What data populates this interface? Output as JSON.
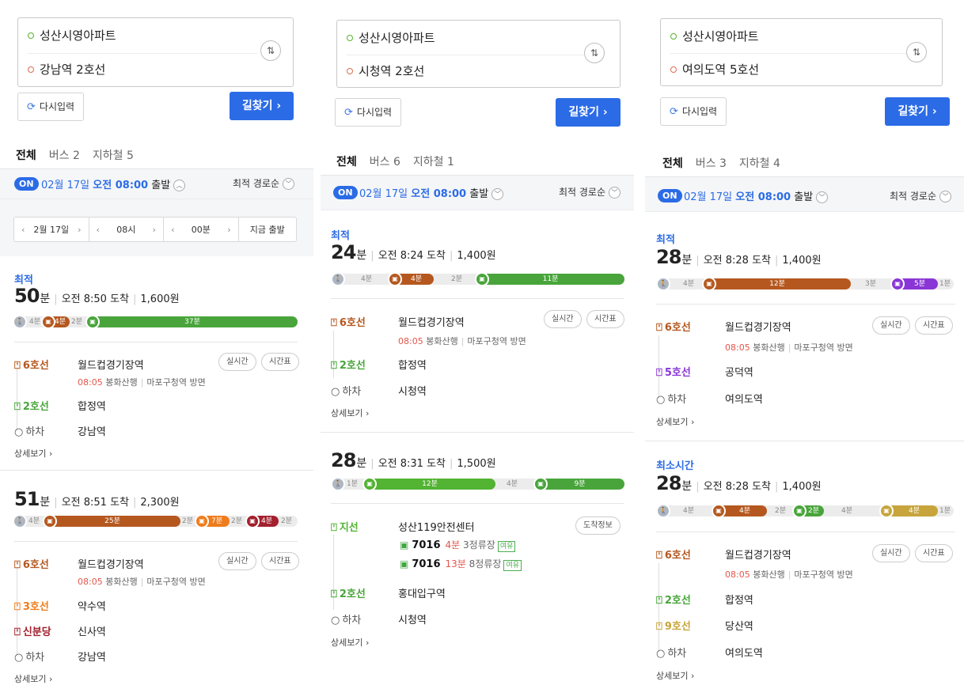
{
  "panels": [
    {
      "from": "성산시영아파트",
      "to": "강남역 2호선",
      "reset": "다시입력",
      "go": "길찾기 ›",
      "tabs": [
        "전체",
        "버스 2",
        "지하철 5"
      ],
      "on": "ON",
      "date": "02월 17일",
      "time": "오전 08:00",
      "dep": "출발",
      "sort": "최적 경로순",
      "timebar": [
        "2월 17일",
        "08시",
        "00분",
        "지금 출발"
      ],
      "routes": [
        {
          "tag": "최적",
          "mins": "50",
          "unit": "분",
          "arr": "오전 8:50 도착",
          "fare": "1,600원",
          "steps": [
            {
              "line": "6호선",
              "stn": "월드컵경기장역",
              "sub1": "08:05",
              "sub2": "봉화산행",
              "sub3": "마포구청역 방면",
              "b1": "실시간",
              "b2": "시간표"
            },
            {
              "line": "2호선",
              "stn": "합정역"
            },
            {
              "line": "하차",
              "stn": "강남역"
            }
          ],
          "more": "상세보기 ›",
          "bar": {
            "segs": [
              "4분",
              "4분",
              "2분",
              "37분"
            ]
          }
        },
        {
          "tag": "",
          "mins": "51",
          "unit": "분",
          "arr": "오전 8:51 도착",
          "fare": "2,300원",
          "steps": [
            {
              "line": "6호선",
              "stn": "월드컵경기장역",
              "sub1": "08:05",
              "sub2": "봉화산행",
              "sub3": "마포구청역 방면",
              "b1": "실시간",
              "b2": "시간표"
            },
            {
              "line": "3호선",
              "stn": "약수역"
            },
            {
              "line": "신분당",
              "stn": "신사역"
            },
            {
              "line": "하차",
              "stn": "강남역"
            }
          ],
          "more": "상세보기 ›",
          "bar": {
            "segs": [
              "4분",
              "25분",
              "2분",
              "7분",
              "2분",
              "4분",
              "2분"
            ]
          }
        }
      ]
    },
    {
      "from": "성산시영아파트",
      "to": "시청역 2호선",
      "reset": "다시입력",
      "go": "길찾기 ›",
      "tabs": [
        "전체",
        "버스 6",
        "지하철 1"
      ],
      "on": "ON",
      "date": "02월 17일",
      "time": "오전 08:00",
      "dep": "출발",
      "sort": "최적 경로순",
      "routes": [
        {
          "tag": "최적",
          "mins": "24",
          "unit": "분",
          "arr": "오전 8:24 도착",
          "fare": "1,400원",
          "steps": [
            {
              "line": "6호선",
              "stn": "월드컵경기장역",
              "sub1": "08:05",
              "sub2": "봉화산행",
              "sub3": "마포구청역 방면",
              "b1": "실시간",
              "b2": "시간표"
            },
            {
              "line": "2호선",
              "stn": "합정역"
            },
            {
              "line": "하차",
              "stn": "시청역"
            }
          ],
          "more": "상세보기 ›",
          "bar": {
            "segs": [
              "4분",
              "4분",
              "2분",
              "11분"
            ]
          }
        },
        {
          "tag": "",
          "mins": "28",
          "unit": "분",
          "arr": "오전 8:31 도착",
          "fare": "1,500원",
          "steps": [
            {
              "line": "지선",
              "stn": "성산119안전센터",
              "b1": "도착정보"
            },
            {
              "line": "2호선",
              "stn": "홍대입구역"
            },
            {
              "line": "하차",
              "stn": "시청역"
            }
          ],
          "more": "상세보기 ›",
          "buses": [
            {
              "no": "7016",
              "rem": "4분",
              "st": "3정류장",
              "yu": "여유"
            },
            {
              "no": "7016",
              "rem": "13분",
              "st": "8정류장",
              "yu": "여유"
            }
          ],
          "bar": {
            "segs": [
              "1분",
              "12분",
              "4분",
              "9분"
            ]
          }
        }
      ]
    },
    {
      "from": "성산시영아파트",
      "to": "여의도역 5호선",
      "reset": "다시입력",
      "go": "길찾기 ›",
      "tabs": [
        "전체",
        "버스 3",
        "지하철 4"
      ],
      "on": "ON",
      "date": "02월 17일",
      "time": "오전 08:00",
      "dep": "출발",
      "sort": "최적 경로순",
      "routes": [
        {
          "tag": "최적",
          "mins": "28",
          "unit": "분",
          "arr": "오전 8:28 도착",
          "fare": "1,400원",
          "steps": [
            {
              "line": "6호선",
              "stn": "월드컵경기장역",
              "sub1": "08:05",
              "sub2": "봉화산행",
              "sub3": "마포구청역 방면",
              "b1": "실시간",
              "b2": "시간표"
            },
            {
              "line": "5호선",
              "stn": "공덕역"
            },
            {
              "line": "하차",
              "stn": "여의도역"
            }
          ],
          "more": "상세보기 ›",
          "bar": {
            "segs": [
              "4분",
              "12분",
              "3분",
              "5분",
              "1분"
            ]
          }
        },
        {
          "tag": "최소시간",
          "mins": "28",
          "unit": "분",
          "arr": "오전 8:28 도착",
          "fare": "1,400원",
          "steps": [
            {
              "line": "6호선",
              "stn": "월드컵경기장역",
              "sub1": "08:05",
              "sub2": "봉화산행",
              "sub3": "마포구청역 방면",
              "b1": "실시간",
              "b2": "시간표"
            },
            {
              "line": "2호선",
              "stn": "합정역"
            },
            {
              "line": "9호선",
              "stn": "당산역"
            },
            {
              "line": "하차",
              "stn": "여의도역"
            }
          ],
          "more": "상세보기 ›",
          "bar": {
            "segs": [
              "4분",
              "4분",
              "2분",
              "2분",
              "4분",
              "4분",
              "1분"
            ]
          }
        }
      ]
    }
  ],
  "colors": {
    "line6": "#b5581f",
    "line2": "#49a53b",
    "line3": "#ef7c1c",
    "shinbundang": "#a3202e",
    "line5": "#8a36d6",
    "line9": "#c7a53c",
    "bus_branch": "#53b332",
    "walk": "#aeb7c1",
    "accent": "#2b6be6"
  },
  "icons": [
    "swap-icon",
    "refresh-icon",
    "chevron-down-icon",
    "train-icon",
    "bus-icon",
    "walk-icon"
  ]
}
